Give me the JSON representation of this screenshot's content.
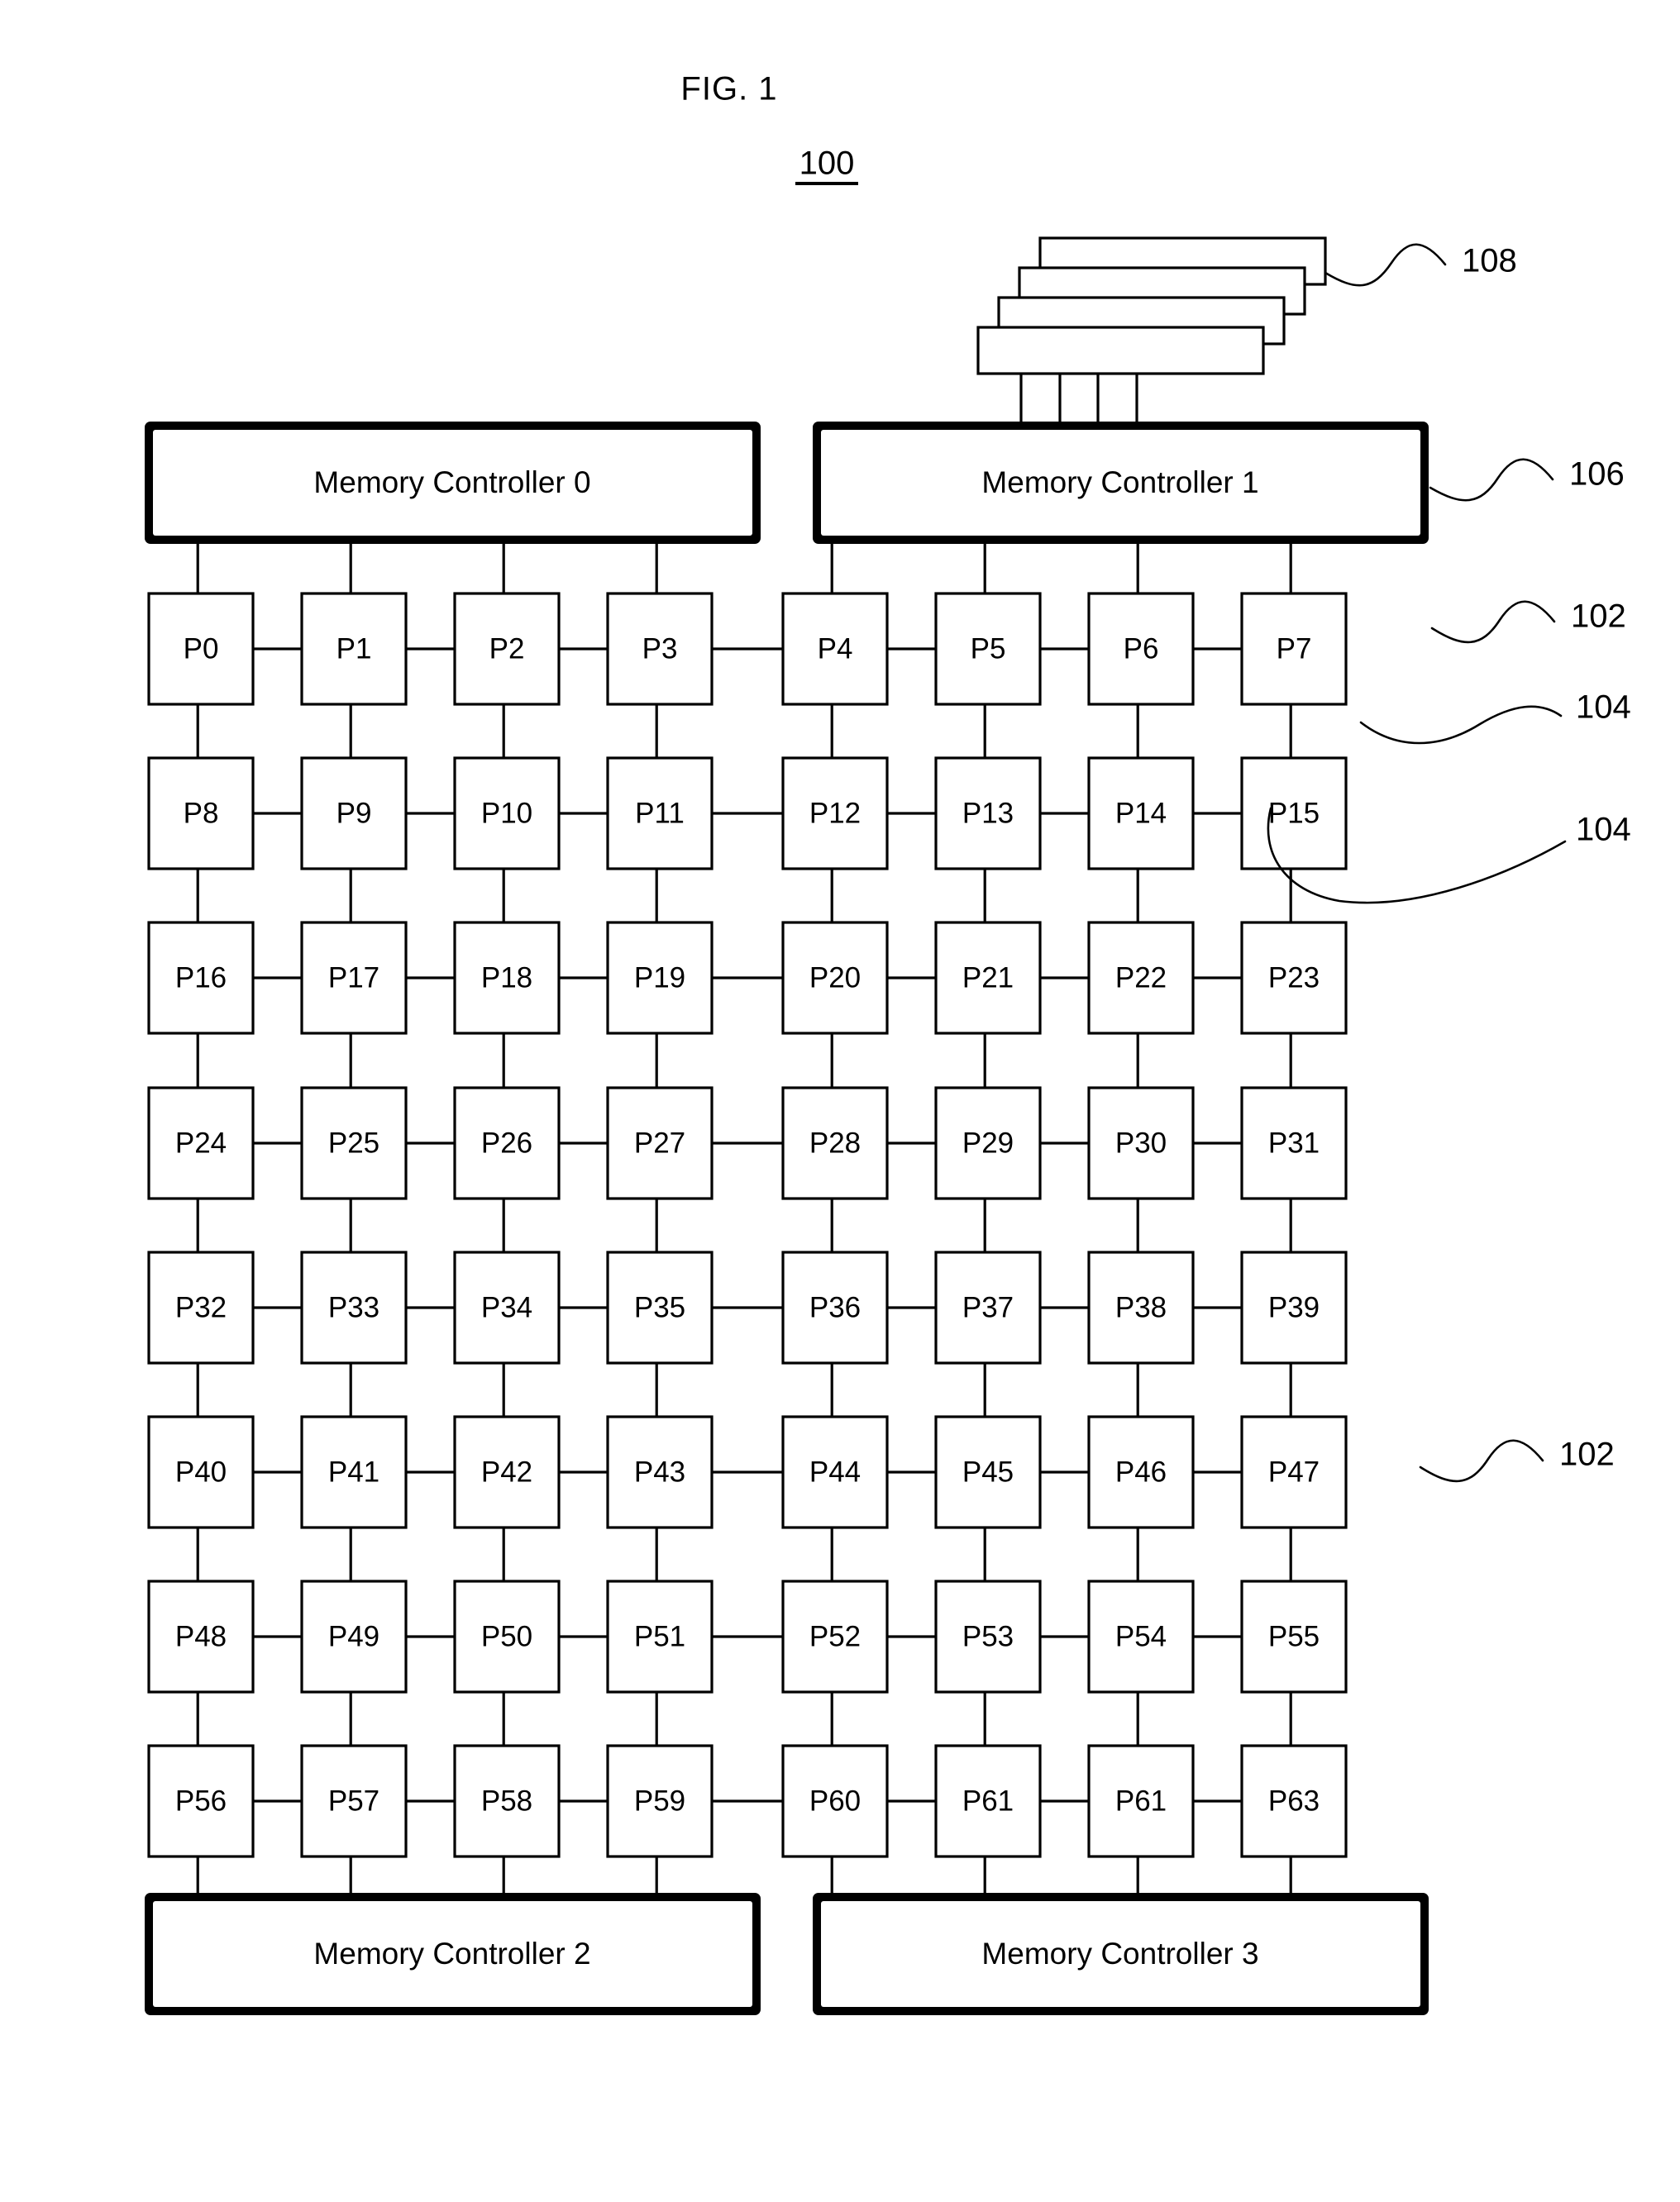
{
  "figure": {
    "title": "FIG. 1",
    "number": "100"
  },
  "memory_controllers": [
    {
      "id": "mc0",
      "label": "Memory Controller 0",
      "position": "top-left"
    },
    {
      "id": "mc1",
      "label": "Memory Controller 1",
      "position": "top-right"
    },
    {
      "id": "mc2",
      "label": "Memory Controller 2",
      "position": "bottom-left"
    },
    {
      "id": "mc3",
      "label": "Memory Controller 3",
      "position": "bottom-right"
    }
  ],
  "processor_grid": {
    "rows": 8,
    "columns": 8,
    "cells": [
      [
        "P0",
        "P1",
        "P2",
        "P3",
        "P4",
        "P5",
        "P6",
        "P7"
      ],
      [
        "P8",
        "P9",
        "P10",
        "P11",
        "P12",
        "P13",
        "P14",
        "P15"
      ],
      [
        "P16",
        "P17",
        "P18",
        "P19",
        "P20",
        "P21",
        "P22",
        "P23"
      ],
      [
        "P24",
        "P25",
        "P26",
        "P27",
        "P28",
        "P29",
        "P30",
        "P31"
      ],
      [
        "P32",
        "P33",
        "P34",
        "P35",
        "P36",
        "P37",
        "P38",
        "P39"
      ],
      [
        "P40",
        "P41",
        "P42",
        "P43",
        "P44",
        "P45",
        "P46",
        "P47"
      ],
      [
        "P48",
        "P49",
        "P50",
        "P51",
        "P52",
        "P53",
        "P54",
        "P55"
      ],
      [
        "P56",
        "P57",
        "P58",
        "P59",
        "P60",
        "P61",
        "P61",
        "P63"
      ]
    ]
  },
  "memory_modules": {
    "count": 4,
    "reference": "108"
  },
  "reference_numerals": [
    {
      "id": "ref-108",
      "label": "108",
      "points_to": "memory-module-stack"
    },
    {
      "id": "ref-106",
      "label": "106",
      "points_to": "memory-controller-1"
    },
    {
      "id": "ref-102-a",
      "label": "102",
      "points_to": "processing-element-p7"
    },
    {
      "id": "ref-104-a",
      "label": "104",
      "points_to": "vertical-link-p7-p15"
    },
    {
      "id": "ref-104-b",
      "label": "104",
      "points_to": "horizontal-link-p14-p15"
    },
    {
      "id": "ref-102-b",
      "label": "102",
      "points_to": "processing-element-p47"
    }
  ],
  "colors": {
    "ink": "#000000",
    "paper": "#ffffff"
  }
}
